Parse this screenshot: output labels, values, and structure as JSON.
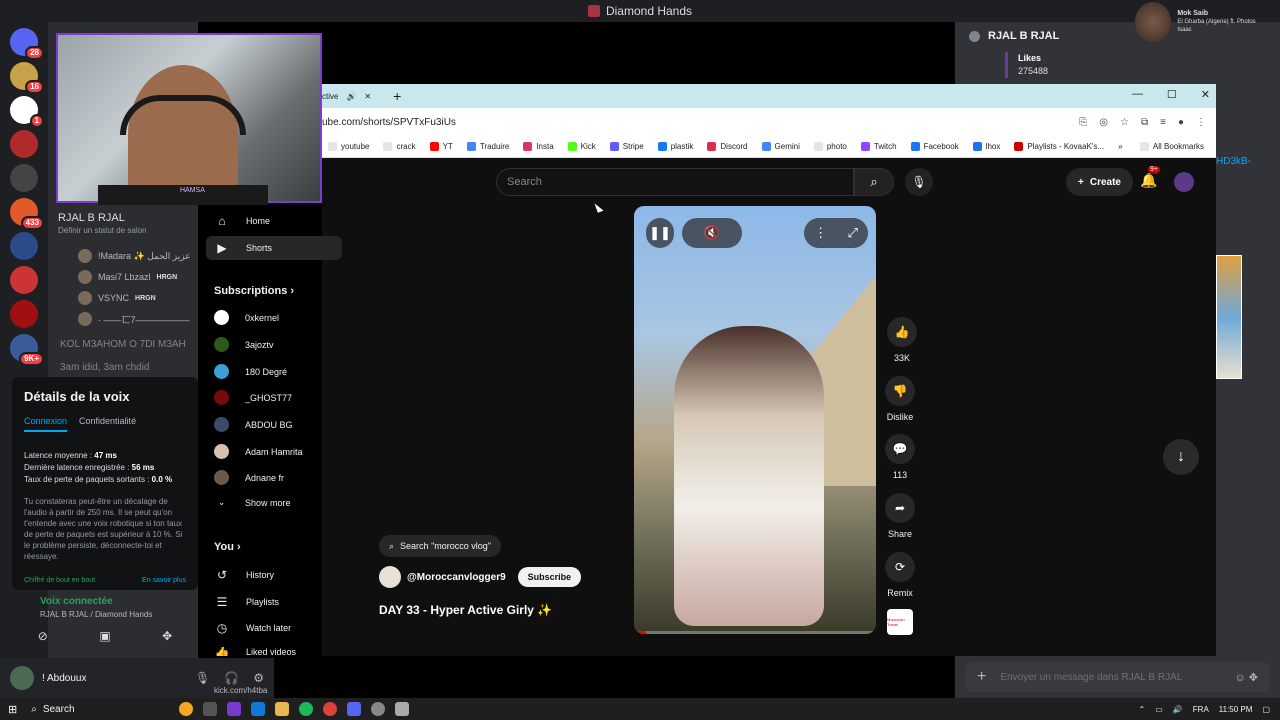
{
  "discord": {
    "window_title": "Diamond Hands",
    "server_badges": [
      "28",
      "16",
      "1",
      "433",
      "9K+"
    ],
    "voice_channel": "RJAL B RJAL",
    "status_placeholder": "Définir un statut de salon",
    "voice_users": [
      {
        "name": "!Madara ✨ عزيز الحمل",
        "tag": ""
      },
      {
        "name": "Masi7 Lbzazl",
        "tag": "HRGN"
      },
      {
        "name": "VSYNC",
        "tag": "HRGN"
      },
      {
        "name": "· ——匸7——————",
        "tag": ""
      }
    ],
    "channels": [
      "KOL M3AHOM O 7DI M3AH",
      "3am idid, 3am chdid"
    ],
    "voice_details": {
      "title": "Détails de la voix",
      "tab_connection": "Connexion",
      "tab_privacy": "Confidentialité",
      "avg_latency_label": "Latence moyenne :",
      "avg_latency": "47 ms",
      "last_latency_label": "Dernière latence enregistrée :",
      "last_latency": "56 ms",
      "loss_label": "Taux de perte de paquets sortants :",
      "loss": "0.0 %",
      "description": "Tu constateras peut-être un décalage de l'audio à partir de 250 ms. Il se peut qu'on t'entende avec une voix robotique si ton taux de perte de paquets est supérieur à 10 %. Si le problème persiste, déconnecte-toi et réessaye.",
      "encrypted": "Chiffré de bout en bout",
      "learn_more": "En savoir plus"
    },
    "voice_connected": "Voix connectée",
    "voice_connected_sub": "RJAL B RJAL / Diamond Hands",
    "user": {
      "name": "! Abdouux",
      "sub": "kick.com/h4tba"
    },
    "right_channel": "RJAL B RJAL",
    "likes_label": "Likes",
    "likes_value": "275488",
    "message_placeholder": "Envoyer un message dans RJAL B RJAL",
    "now_playing_title": "Mok Saib",
    "now_playing_sub": "El Gharba (Algerie) ft. Photos Isaac",
    "right_link": "HD3kB-",
    "cam_logo": "HAMSA"
  },
  "browser": {
    "tab_title": "ctive",
    "url": "ube.com/shorts/SPVTxFu3iUs",
    "bookmarks": [
      {
        "label": "youtube",
        "color": "#e5e5e5"
      },
      {
        "label": "crack",
        "color": "#e5e5e5"
      },
      {
        "label": "YT",
        "color": "#ff0000"
      },
      {
        "label": "Traduire",
        "color": "#4285f4"
      },
      {
        "label": "Insta",
        "color": "#e1306c"
      },
      {
        "label": "Kick",
        "color": "#53fc18"
      },
      {
        "label": "Stripe",
        "color": "#635bff"
      },
      {
        "label": "plastik",
        "color": "#1877f2"
      },
      {
        "label": "Discord",
        "color": "#d9304f"
      },
      {
        "label": "Gemini",
        "color": "#4285f4"
      },
      {
        "label": "photo",
        "color": "#e5e5e5"
      },
      {
        "label": "Twitch",
        "color": "#9146ff"
      },
      {
        "label": "Facebook",
        "color": "#1877f2"
      },
      {
        "label": "lhox",
        "color": "#1a73e8"
      },
      {
        "label": "Playlists - KovaaK's...",
        "color": "#c00"
      }
    ],
    "all_bookmarks": "All Bookmarks"
  },
  "youtube": {
    "search_placeholder": "Search",
    "create": "Create",
    "notif_count": "9+",
    "nav": [
      {
        "label": "Home",
        "icon": "home-icon"
      },
      {
        "label": "Shorts",
        "icon": "shorts-icon"
      }
    ],
    "subscriptions_header": "Subscriptions",
    "subscriptions": [
      {
        "name": "0xkernel",
        "color": "#fff"
      },
      {
        "name": "3ajoztv",
        "color": "#2d5a1b"
      },
      {
        "name": "180 Degré",
        "color": "#3aa0d8"
      },
      {
        "name": "_GHOST77",
        "color": "#7a0a0a"
      },
      {
        "name": "ABDOU BG",
        "color": "#3a4a6a"
      },
      {
        "name": "Adam Hamrita",
        "color": "#d8c0b0"
      },
      {
        "name": "Adnane fr",
        "color": "#6a5a4a"
      }
    ],
    "show_more": "Show more",
    "you_header": "You",
    "you_items": [
      {
        "label": "History",
        "icon": "history-icon"
      },
      {
        "label": "Playlists",
        "icon": "playlists-icon"
      },
      {
        "label": "Watch later",
        "icon": "watch-later-icon"
      },
      {
        "label": "Liked videos",
        "icon": "liked-icon"
      }
    ],
    "search_chip": "Search \"morocco vlog\"",
    "channel_name": "@Moroccanvlogger9",
    "subscribe": "Subscribe",
    "video_title": "DAY 33 - Hyper Active Girly ✨",
    "video_progress": 0.05,
    "likes": "33K",
    "dislike": "Dislike",
    "comments": "113",
    "share": "Share",
    "remix": "Remix",
    "thumb_text": "Moroccan Travel"
  },
  "taskbar": {
    "search": "Search",
    "lang": "FRA",
    "time": "11:50 PM"
  }
}
